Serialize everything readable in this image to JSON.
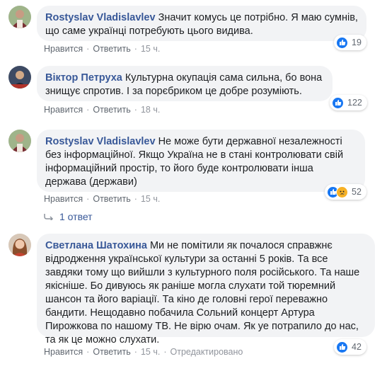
{
  "actions": {
    "like": "Нравится",
    "reply": "Ответить",
    "sep": "·"
  },
  "comments": [
    {
      "author": "Rostyslav Vladislavlev",
      "text": "Значит комусь це потрібно. Я маю сумнів, що саме українці потребують цього видива.",
      "time": "15 ч.",
      "reactions": 19,
      "reaction_icons": [
        "like-icon"
      ]
    },
    {
      "author": "Віктор Петруха",
      "text": "Культурна окупація сама сильна, бо вона знищує спротив. І за порєбриком це добре розуміють.",
      "time": "18 ч.",
      "reactions": 122,
      "reaction_icons": [
        "like-icon"
      ]
    },
    {
      "author": "Rostyslav Vladislavlev",
      "text": "Не може бути державної незалежності без інформаційної. Якщо Україна не в стані контролювати свій інформаційний простір, то його буде контролювати інша держава (держави)",
      "time": "15 ч.",
      "reactions": 52,
      "reaction_icons": [
        "like-icon",
        "sad-icon"
      ],
      "replies_label": "1 ответ"
    },
    {
      "author": "Светлана Шатохина",
      "text": "Ми не помітили як почалося справжнє відродження української культури за останні 5 років. Та все завдяки тому що вийшли з культурного поля російського. Та наше якісніше. Бо дивуюсь як раніше могла слухати той тюремний шансон та його варіації. Та кіно де головні герої переважно бандити. Нещодавно побачила Сольний концерт Артура Пирожкова по нашому ТВ. Не вірю очам. Як уе потрапило до нас, та як це можно слухати.",
      "time": "15 ч.",
      "edited": "Отредактировано",
      "reactions": 42,
      "reaction_icons": [
        "like-icon"
      ]
    }
  ],
  "colors": {
    "link": "#385898",
    "like": "#1877f2",
    "bubble": "#f2f3f5",
    "meta": "#90949c"
  }
}
